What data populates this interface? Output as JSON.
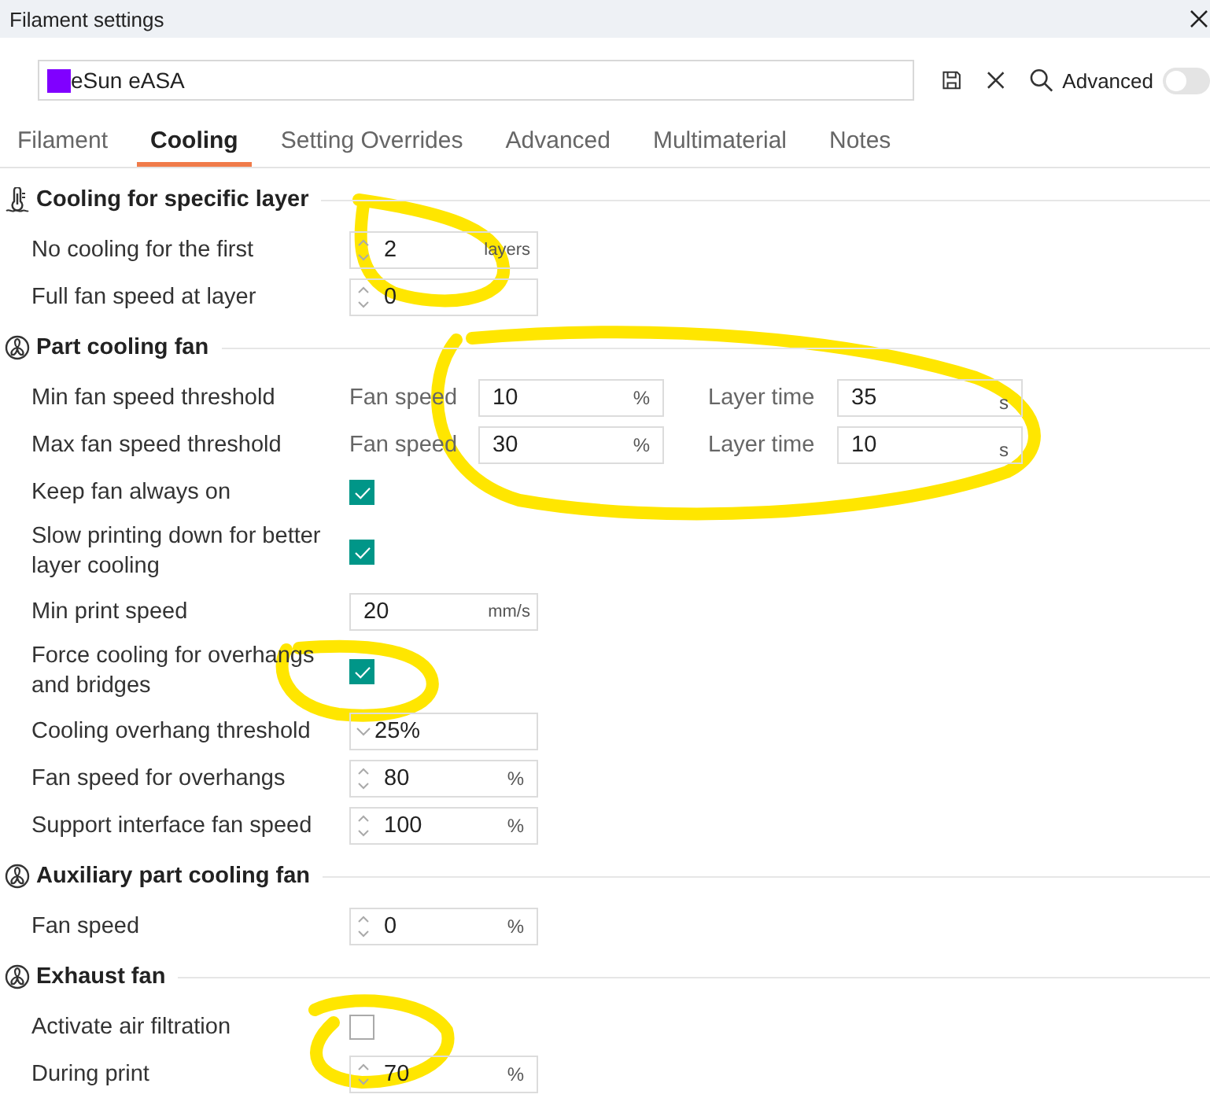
{
  "window": {
    "title": "Filament settings"
  },
  "preset": {
    "name": "eSun eASA",
    "color": "#8000ff"
  },
  "toolbar": {
    "advanced_label": "Advanced",
    "advanced_on": false
  },
  "tabs": [
    {
      "label": "Filament",
      "selected": false
    },
    {
      "label": "Cooling",
      "selected": true
    },
    {
      "label": "Setting Overrides",
      "selected": false
    },
    {
      "label": "Advanced",
      "selected": false
    },
    {
      "label": "Multimaterial",
      "selected": false
    },
    {
      "label": "Notes",
      "selected": false
    }
  ],
  "sections": [
    {
      "title": "Cooling for specific layer",
      "rows": [
        {
          "kind": "spin",
          "label": "No cooling for the first",
          "value": "2",
          "unit": "layers"
        },
        {
          "kind": "spin",
          "label": "Full fan speed at layer",
          "value": "0"
        }
      ]
    },
    {
      "title": "Part cooling fan",
      "rows": [
        {
          "kind": "dual",
          "label": "Min fan speed threshold",
          "fields": [
            {
              "label": "Fan speed",
              "value": "10",
              "unit": "%"
            },
            {
              "label": "Layer time",
              "value": "35",
              "unit": "s"
            }
          ]
        },
        {
          "kind": "dual",
          "label": "Max fan speed threshold",
          "fields": [
            {
              "label": "Fan speed",
              "value": "30",
              "unit": "%"
            },
            {
              "label": "Layer time",
              "value": "10",
              "unit": "s"
            }
          ]
        },
        {
          "kind": "checkbox",
          "label": "Keep fan always on",
          "checked": true
        },
        {
          "kind": "checkbox",
          "label": "Slow printing down for better layer cooling",
          "checked": true
        },
        {
          "kind": "text",
          "label": "Min print speed",
          "value": "20",
          "unit": "mm/s"
        },
        {
          "kind": "checkbox",
          "label": "Force cooling for overhangs and bridges",
          "checked": true
        },
        {
          "kind": "dropdown",
          "label": "Cooling overhang threshold",
          "value": "25%"
        },
        {
          "kind": "spin",
          "label": "Fan speed for overhangs",
          "value": "80",
          "unit": "%"
        },
        {
          "kind": "spin",
          "label": "Support interface fan speed",
          "value": "100",
          "unit": "%"
        }
      ]
    },
    {
      "title": "Auxiliary part cooling fan",
      "rows": [
        {
          "kind": "spin",
          "label": "Fan speed",
          "value": "0",
          "unit": "%"
        }
      ]
    },
    {
      "title": "Exhaust fan",
      "rows": [
        {
          "kind": "checkbox",
          "label": "Activate air filtration",
          "checked": false
        },
        {
          "kind": "spin",
          "label": "During print",
          "value": "70",
          "unit": "%"
        }
      ]
    }
  ]
}
